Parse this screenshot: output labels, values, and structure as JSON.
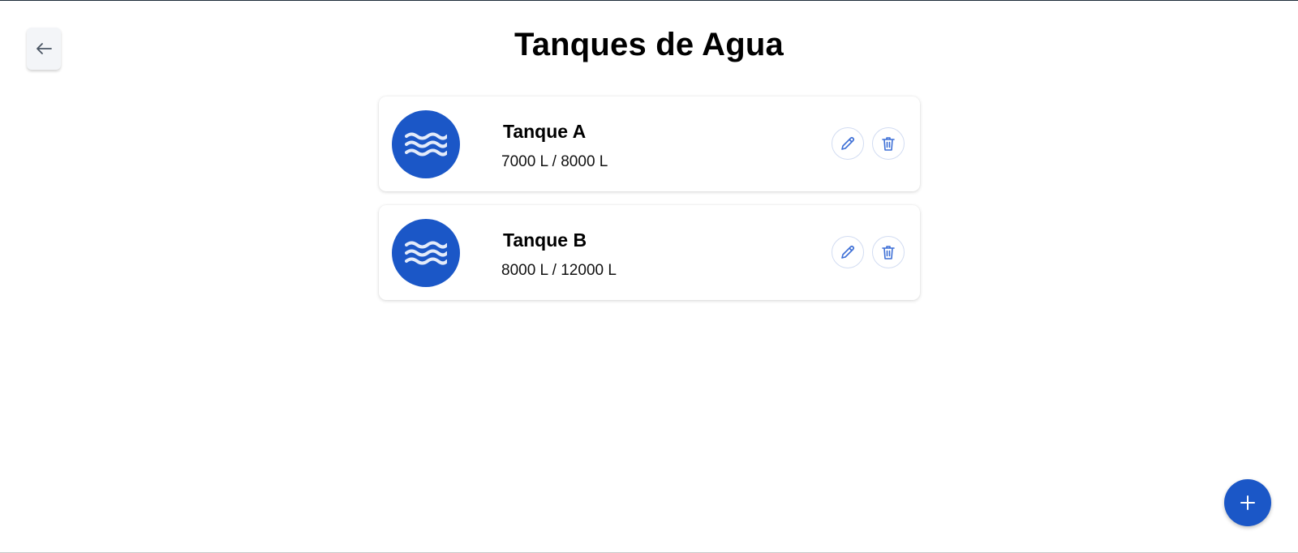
{
  "header": {
    "title": "Tanques de Agua",
    "back_icon": "arrow-left-icon"
  },
  "tanks": [
    {
      "name": "Tanque A",
      "volume": "7000 L / 8000 L",
      "icon": "water-waves-icon"
    },
    {
      "name": "Tanque B",
      "volume": "8000 L / 12000 L",
      "icon": "water-waves-icon"
    }
  ],
  "actions": {
    "edit_icon": "pencil-icon",
    "delete_icon": "trash-icon",
    "add_icon": "plus-icon"
  },
  "colors": {
    "accent": "#1b57c7",
    "action_icon": "#3d6fd6"
  }
}
